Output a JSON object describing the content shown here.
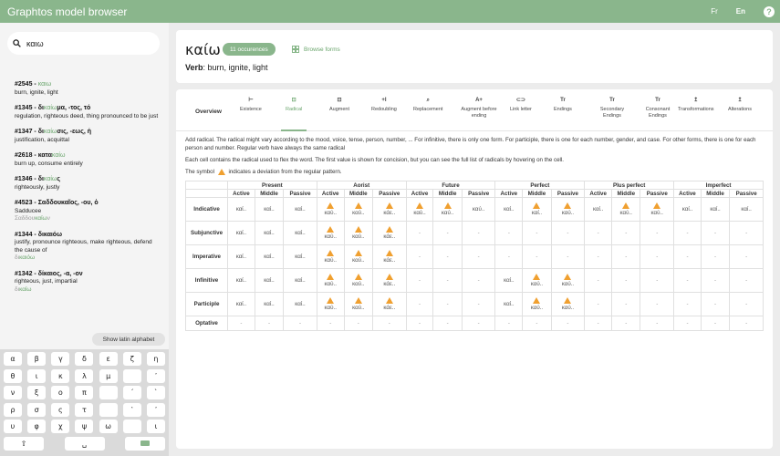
{
  "app": {
    "title": "Graphtos model browser",
    "lang_fr": "Fr",
    "lang_en": "En",
    "help": "?"
  },
  "search": {
    "value": "καιω",
    "placeholder": ""
  },
  "results": [
    {
      "num": "#2545",
      "lemma_pre": "",
      "lemma_hl": "καιω",
      "lemma_post": "",
      "gloss": "burn, ignite, light",
      "extra": ""
    },
    {
      "num": "#1345",
      "lemma_pre": "δι",
      "lemma_hl": "καίω",
      "lemma_post": "μα, -τος, τό",
      "gloss": "regulation, righteous deed, thing pronounced to be just",
      "extra": ""
    },
    {
      "num": "#1347",
      "lemma_pre": "δι",
      "lemma_hl": "καίω",
      "lemma_post": "σις, -εως, ἡ",
      "gloss": "justification, acquittal",
      "extra": ""
    },
    {
      "num": "#2618",
      "lemma_pre": "κατα",
      "lemma_hl": "καίω",
      "lemma_post": "",
      "gloss": "burn up, consume entirely",
      "extra": ""
    },
    {
      "num": "#1346",
      "lemma_pre": "δι",
      "lemma_hl": "καίω",
      "lemma_post": "ς",
      "gloss": "righteously, justly",
      "extra": ""
    },
    {
      "num": "#4523",
      "lemma_pre": "",
      "lemma_hl": "",
      "lemma_post": "Σαδδουκαῖος, -ου, ὁ",
      "gloss": "Sadducee",
      "extra": "Σαδδου",
      "extra_hl": "καίω",
      "extra_post": "ν"
    },
    {
      "num": "#1344",
      "lemma_pre": "",
      "lemma_hl": "",
      "lemma_post": "δικαιόω",
      "gloss": "justify, pronounce righteous, make righteous, defend the cause of",
      "extra": "δι",
      "extra_hl": "καιόω",
      "extra_post": ""
    },
    {
      "num": "#1342",
      "lemma_pre": "",
      "lemma_hl": "",
      "lemma_post": "δίκαιος, -α, -ον",
      "gloss": "righteous, just, impartial",
      "extra": "δι",
      "extra_hl": "καίω",
      "extra_post": ""
    }
  ],
  "latin_button": "Show latin alphabet",
  "keyboard": [
    [
      "α",
      "β",
      "γ",
      "δ",
      "ε",
      "ζ",
      "η"
    ],
    [
      "θ",
      "ι",
      "κ",
      "λ",
      "μ",
      "",
      "᾿"
    ],
    [
      "ν",
      "ξ",
      "ο",
      "π",
      "",
      "´",
      "`"
    ],
    [
      "ρ",
      "σ",
      "ς",
      "τ",
      "",
      "῾",
      "᾽"
    ],
    [
      "υ",
      "φ",
      "χ",
      "ψ",
      "ω",
      "",
      "ι"
    ]
  ],
  "keyboard_bottom": {
    "shift": "⇧",
    "space": "␣"
  },
  "header": {
    "word": "καίω",
    "occurrences": "11 occurences",
    "browse": "Browse forms",
    "pos": "Verb",
    "gloss": ": burn, ignite, light"
  },
  "tabs": [
    {
      "icon": "",
      "label": "Overview"
    },
    {
      "icon": "⊢",
      "label": "Existence"
    },
    {
      "icon": "⊡",
      "label": "Radical"
    },
    {
      "icon": "⊡",
      "label": "Augment"
    },
    {
      "icon": "+I",
      "label": "Redoubling"
    },
    {
      "icon": "⌕",
      "label": "Replacement"
    },
    {
      "icon": "A+",
      "label": "Augment before ending"
    },
    {
      "icon": "⊂⊃",
      "label": "Link letter"
    },
    {
      "icon": "Tr",
      "label": "Endings"
    },
    {
      "icon": "Tr",
      "label": "Secondary Endings"
    },
    {
      "icon": "Tr",
      "label": "Consonant Endings"
    },
    {
      "icon": "↥",
      "label": "Transformations"
    },
    {
      "icon": "↥",
      "label": "Alterations"
    }
  ],
  "desc1": "Add radical. The radical might vary according to the mood, voice, tense, person, number, ... For infinitive, there is only one form. For participle, there is one for each number, gender, and case. For other forms, there is one for each person and number. Regular verb have always the same radical",
  "desc2": "Each cell contains the radical used to flex the word. The first value is shown for concision, but you can see the full list of radicals by hovering on the cell.",
  "desc3_pre": "The symbol",
  "desc3_post": "indicates a deviation from the regular pattern.",
  "tenses": [
    "Present",
    "Aorist",
    "Future",
    "Perfect",
    "Plus perfect",
    "Imperfect"
  ],
  "voices": [
    "Active",
    "Middle",
    "Passive"
  ],
  "moods": [
    {
      "name": "Indicative",
      "cells": [
        [
          "καί..",
          0
        ],
        [
          "καί..",
          0
        ],
        [
          "καί..",
          0
        ],
        [
          "καύ..",
          1
        ],
        [
          "καύ..",
          1
        ],
        [
          "κάε..",
          1
        ],
        [
          "καύ..",
          1
        ],
        [
          "καύ..",
          1
        ],
        [
          "καύ..",
          0
        ],
        [
          "καί..",
          0
        ],
        [
          "καί..",
          1
        ],
        [
          "καύ..",
          1
        ],
        [
          "καί..",
          0
        ],
        [
          "καύ..",
          1
        ],
        [
          "καύ..",
          1
        ],
        [
          "καί..",
          0
        ],
        [
          "καί..",
          0
        ],
        [
          "καί..",
          0
        ]
      ]
    },
    {
      "name": "Subjunctive",
      "cells": [
        [
          "καί..",
          0
        ],
        [
          "καί..",
          0
        ],
        [
          "καί..",
          0
        ],
        [
          "καύ..",
          1
        ],
        [
          "καύ..",
          1
        ],
        [
          "κάε..",
          1
        ],
        [
          "-",
          0
        ],
        [
          "-",
          0
        ],
        [
          "-",
          0
        ],
        [
          "-",
          0
        ],
        [
          "-",
          0
        ],
        [
          "-",
          0
        ],
        [
          "-",
          0
        ],
        [
          "-",
          0
        ],
        [
          "-",
          0
        ],
        [
          "-",
          0
        ],
        [
          "-",
          0
        ],
        [
          "-",
          0
        ]
      ]
    },
    {
      "name": "Imperative",
      "cells": [
        [
          "καί..",
          0
        ],
        [
          "καί..",
          0
        ],
        [
          "καί..",
          0
        ],
        [
          "καύ..",
          1
        ],
        [
          "καύ..",
          1
        ],
        [
          "κάε..",
          1
        ],
        [
          "-",
          0
        ],
        [
          "-",
          0
        ],
        [
          "-",
          0
        ],
        [
          "-",
          0
        ],
        [
          "-",
          0
        ],
        [
          "-",
          0
        ],
        [
          "-",
          0
        ],
        [
          "-",
          0
        ],
        [
          "-",
          0
        ],
        [
          "-",
          0
        ],
        [
          "-",
          0
        ],
        [
          "-",
          0
        ]
      ]
    },
    {
      "name": "Infinitive",
      "cells": [
        [
          "καί..",
          0
        ],
        [
          "καί..",
          0
        ],
        [
          "καί..",
          0
        ],
        [
          "καύ..",
          1
        ],
        [
          "καύ..",
          1
        ],
        [
          "κάε..",
          1
        ],
        [
          "-",
          0
        ],
        [
          "-",
          0
        ],
        [
          "-",
          0
        ],
        [
          "καί..",
          0
        ],
        [
          "καύ..",
          1
        ],
        [
          "καύ..",
          1
        ],
        [
          "-",
          0
        ],
        [
          "-",
          0
        ],
        [
          "-",
          0
        ],
        [
          "-",
          0
        ],
        [
          "-",
          0
        ],
        [
          "-",
          0
        ]
      ]
    },
    {
      "name": "Participle",
      "cells": [
        [
          "καί..",
          0
        ],
        [
          "καί..",
          0
        ],
        [
          "καί..",
          0
        ],
        [
          "καύ..",
          1
        ],
        [
          "καύ..",
          1
        ],
        [
          "κάε..",
          1
        ],
        [
          "-",
          0
        ],
        [
          "-",
          0
        ],
        [
          "-",
          0
        ],
        [
          "καί..",
          0
        ],
        [
          "καύ..",
          1
        ],
        [
          "καύ..",
          1
        ],
        [
          "-",
          0
        ],
        [
          "-",
          0
        ],
        [
          "-",
          0
        ],
        [
          "-",
          0
        ],
        [
          "-",
          0
        ],
        [
          "-",
          0
        ]
      ]
    },
    {
      "name": "Optative",
      "cells": [
        [
          "-",
          0
        ],
        [
          "-",
          0
        ],
        [
          "-",
          0
        ],
        [
          "-",
          0
        ],
        [
          "-",
          0
        ],
        [
          "-",
          0
        ],
        [
          "-",
          0
        ],
        [
          "-",
          0
        ],
        [
          "-",
          0
        ],
        [
          "-",
          0
        ],
        [
          "-",
          0
        ],
        [
          "-",
          0
        ],
        [
          "-",
          0
        ],
        [
          "-",
          0
        ],
        [
          "-",
          0
        ],
        [
          "-",
          0
        ],
        [
          "-",
          0
        ],
        [
          "-",
          0
        ]
      ]
    }
  ],
  "colors": {
    "accent": "#8ab68c",
    "accent_text": "#6aa56c",
    "warning": "#f0a030"
  }
}
